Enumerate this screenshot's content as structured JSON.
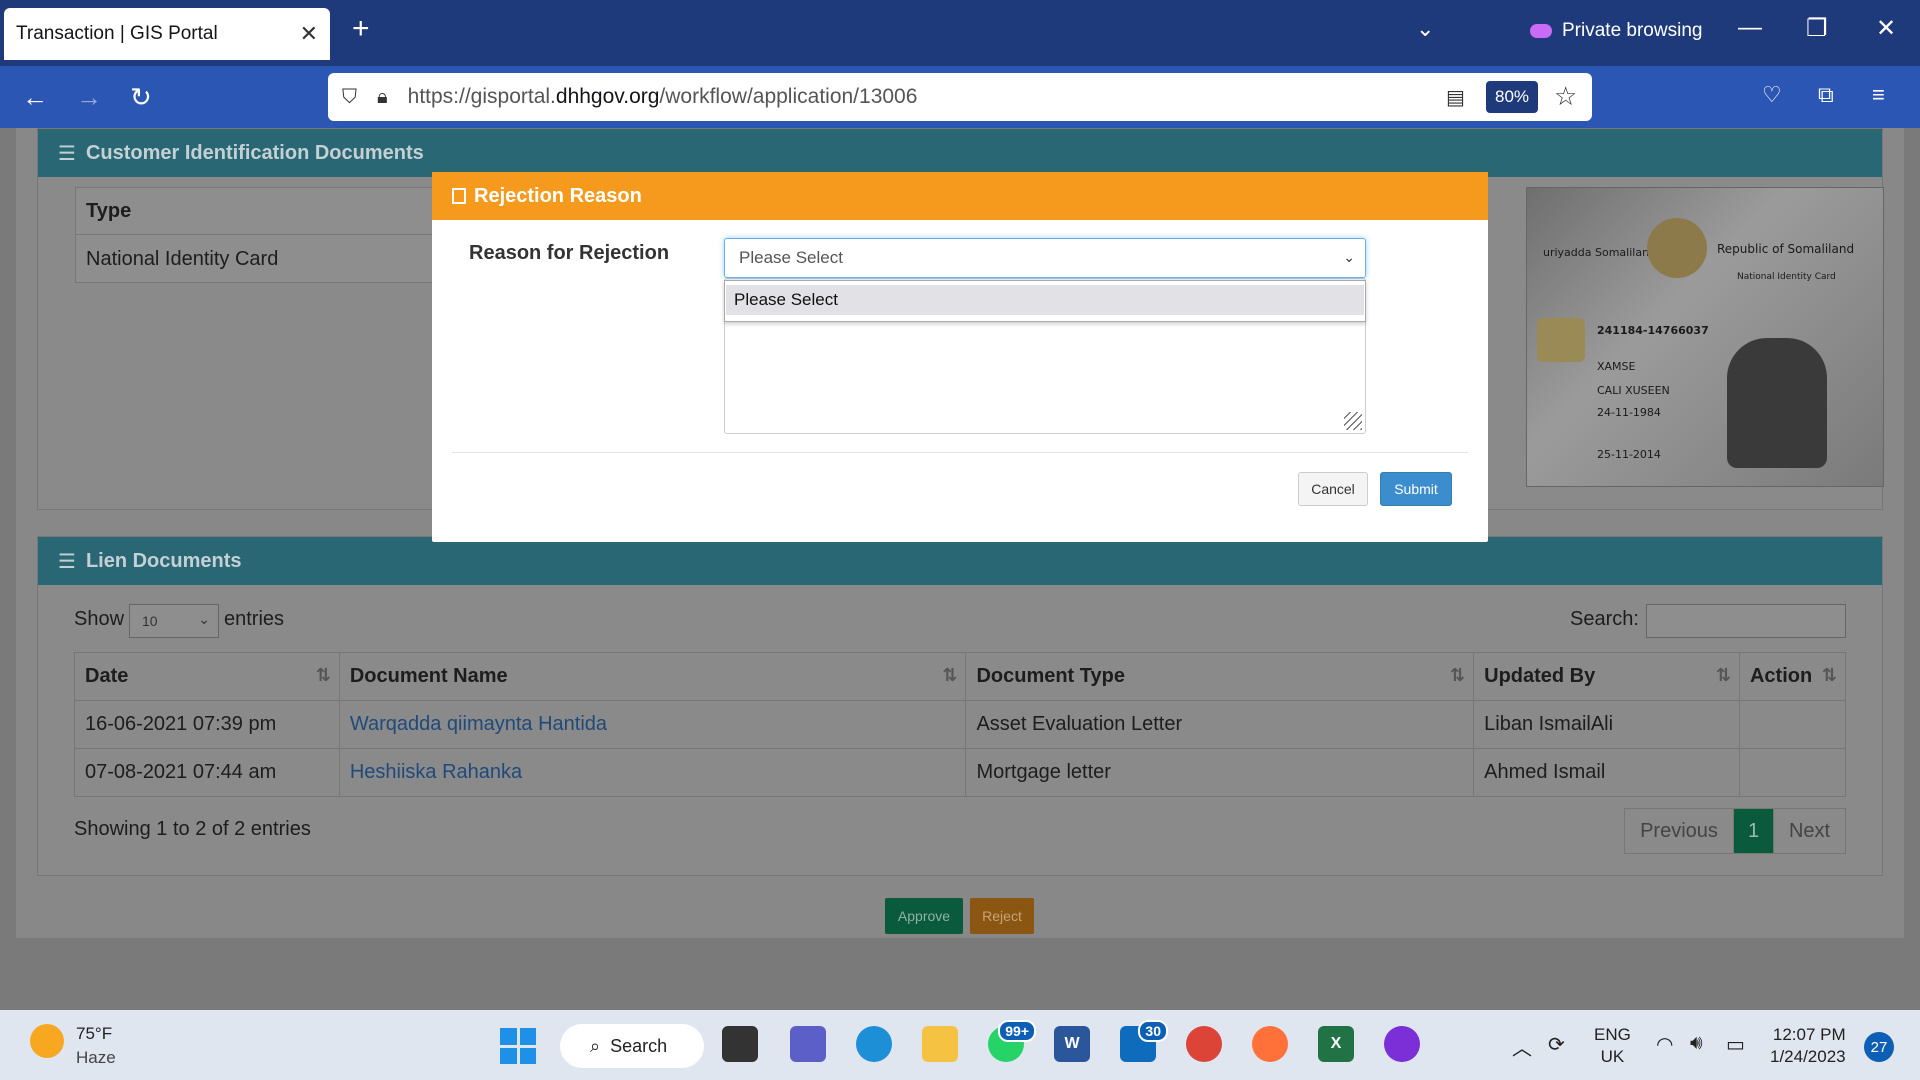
{
  "browser": {
    "tab_title": "Transaction | GIS Portal",
    "private_label": "Private browsing",
    "url_prefix": "https://gisportal.",
    "url_domain": "dhhgov.org",
    "url_path": "/workflow/application/13006",
    "zoom": "80%"
  },
  "page": {
    "customer_docs": {
      "heading": "Customer Identification Documents",
      "type_header": "Type",
      "type_value": "National Identity Card",
      "id_card": {
        "country": "Republic of Somaliland",
        "country_local": "uriyadda Somaliland",
        "card_name": "National Identity Card",
        "id_number": "241184-14766037",
        "name1": "XAMSE",
        "name2": "CALI XUSEEN",
        "dob": "24-11-1984",
        "issue_date": "25-11-2014"
      }
    },
    "lien_docs": {
      "heading": "Lien Documents",
      "show_label": "Show",
      "entries_label": "entries",
      "page_length": "10",
      "search_label": "Search:",
      "columns": [
        "Date",
        "Document Name",
        "Document Type",
        "Updated By",
        "Action"
      ],
      "rows": [
        {
          "date": "16-06-2021 07:39 pm",
          "name": "Warqadda qiimaynta Hantida",
          "type": "Asset Evaluation Letter",
          "by": "Liban IsmailAli",
          "action": ""
        },
        {
          "date": "07-08-2021 07:44 am",
          "name": "Heshiiska Rahanka",
          "type": "Mortgage letter",
          "by": "Ahmed Ismail",
          "action": ""
        }
      ],
      "info": "Showing 1 to 2 of 2 entries",
      "prev": "Previous",
      "page_num": "1",
      "next": "Next"
    },
    "approve": "Approve",
    "reject": "Reject"
  },
  "modal": {
    "title": "Rejection Reason",
    "label": "Reason for Rejection",
    "select_value": "Please Select",
    "dropdown_option": "Please Select",
    "cancel": "Cancel",
    "submit": "Submit"
  },
  "taskbar": {
    "temp": "75°F",
    "weather": "Haze",
    "search": "Search",
    "whatsapp_badge": "99+",
    "mail_badge": "30",
    "lang1": "ENG",
    "lang2": "UK",
    "time": "12:07 PM",
    "date": "1/24/2023",
    "notifications": "27"
  }
}
